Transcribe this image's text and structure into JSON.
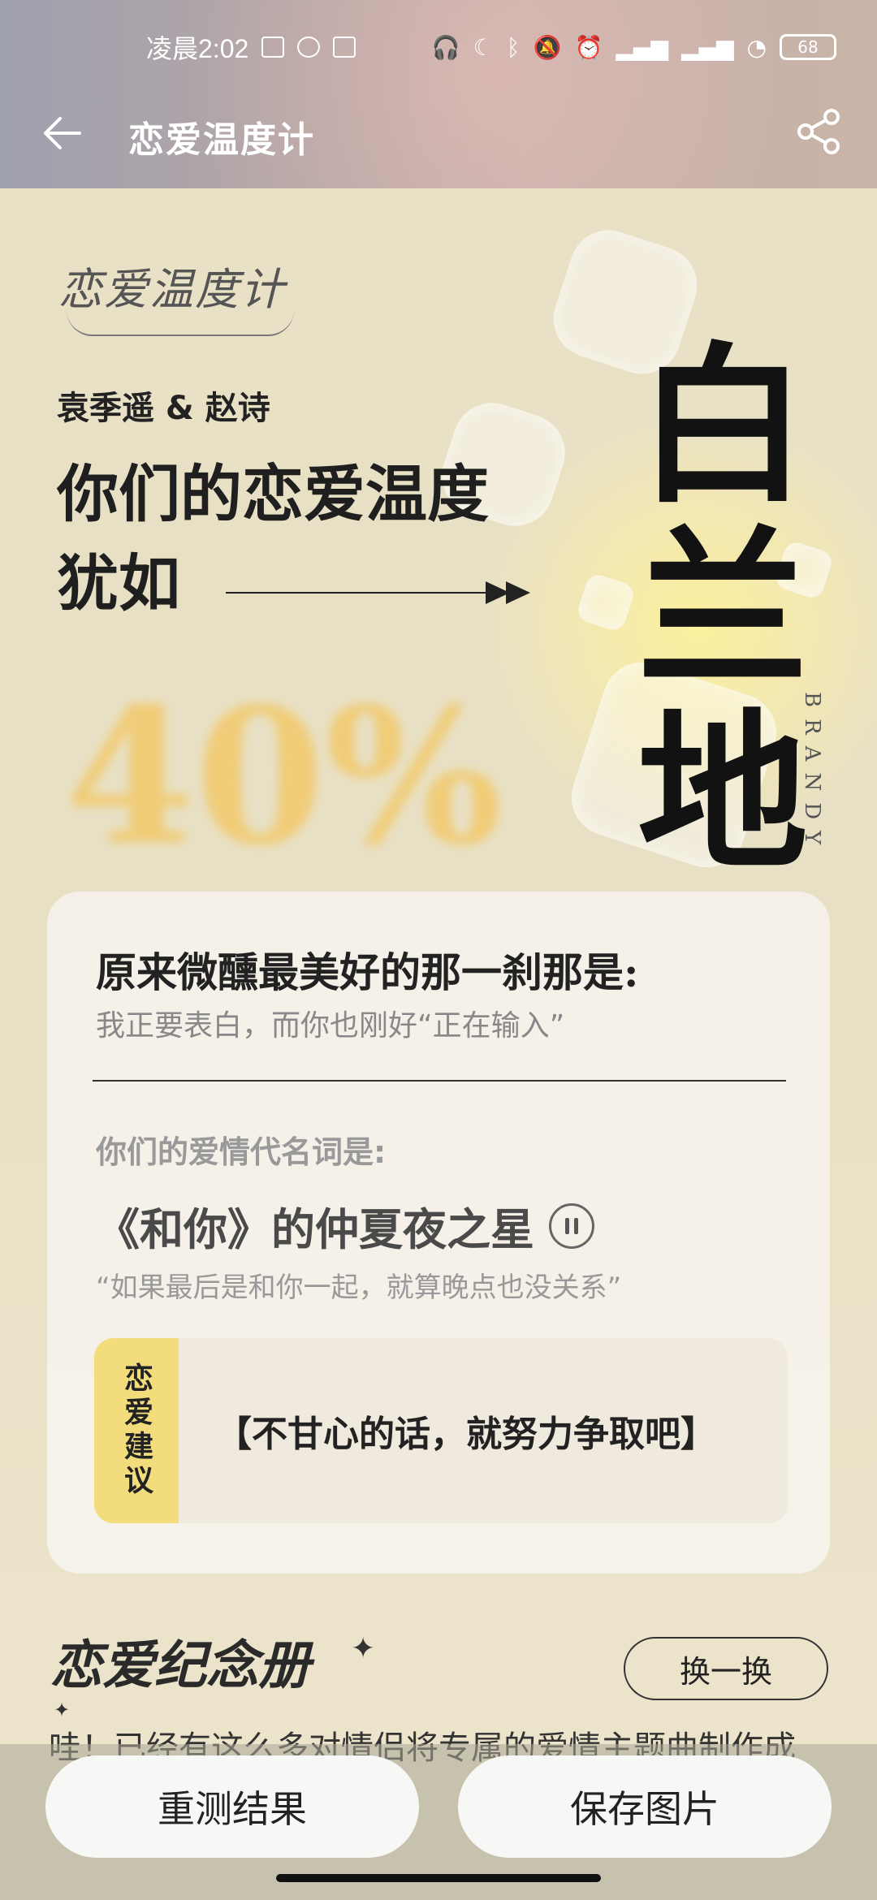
{
  "status_bar": {
    "time": "凌晨2:02",
    "battery": "68"
  },
  "header": {
    "title": "恋爱温度计",
    "back_icon": "arrow-left-icon",
    "share_icon": "share-icon"
  },
  "hero": {
    "logo": "恋爱温度计",
    "names": "袁季遥 & 赵诗",
    "headline_line1": "你们的恋爱温度",
    "headline_line2": "犹如",
    "percent": "40%",
    "drink": "白兰地",
    "drink_en": "BRANDY"
  },
  "card": {
    "q1": "原来微醺最美好的那一刹那是:",
    "a1": "我正要表白，而你也刚好“正在输入”",
    "q2": "你们的爱情代名词是:",
    "song": "《和你》的仲夏夜之星",
    "lyric": "“如果最后是和你一起，就算晚点也没关系”",
    "advice_tag": "恋爱建议",
    "advice": "【不甘心的话，就努力争取吧】"
  },
  "album": {
    "title": "恋爱纪念册",
    "swap_label": "换一换",
    "description": "哇！已经有这么多对情侣将专属的爱情主题曲制作成"
  },
  "actions": {
    "retest": "重测结果",
    "save": "保存图片"
  },
  "colors": {
    "background": "#e7dfc4",
    "accent_yellow": "#f2dc7c",
    "percent_color": "#f2c96a"
  }
}
